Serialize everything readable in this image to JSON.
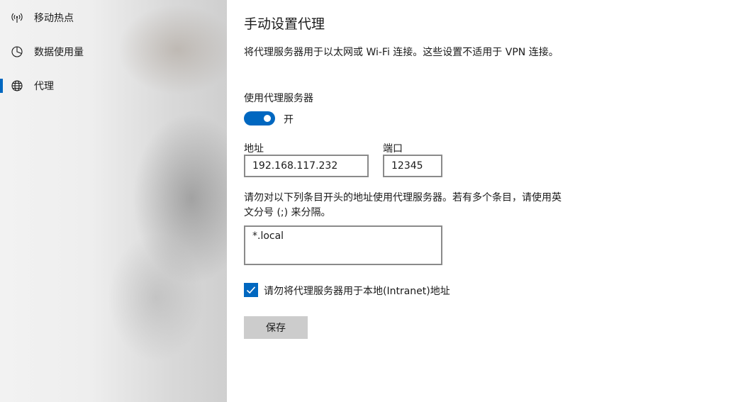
{
  "sidebar": {
    "items": [
      {
        "label": "移动热点",
        "icon": "hotspot-icon",
        "active": false
      },
      {
        "label": "数据使用量",
        "icon": "data-usage-icon",
        "active": false
      },
      {
        "label": "代理",
        "icon": "globe-icon",
        "active": true
      }
    ]
  },
  "main": {
    "title": "手动设置代理",
    "description": "将代理服务器用于以太网或 Wi-Fi 连接。这些设置不适用于 VPN 连接。",
    "use_proxy_label": "使用代理服务器",
    "toggle_state": "开",
    "address_label": "地址",
    "address_value": "192.168.117.232",
    "port_label": "端口",
    "port_value": "12345",
    "exceptions_description": "请勿对以下列条目开头的地址使用代理服务器。若有多个条目，请使用英文分号 (;) 来分隔。",
    "exceptions_value": "*.local",
    "bypass_local_label": "请勿将代理服务器用于本地(Intranet)地址",
    "bypass_local_checked": true,
    "save_label": "保存"
  },
  "colors": {
    "accent": "#0067c0",
    "button_bg": "#cccccc",
    "input_border": "#8a8a8a"
  }
}
